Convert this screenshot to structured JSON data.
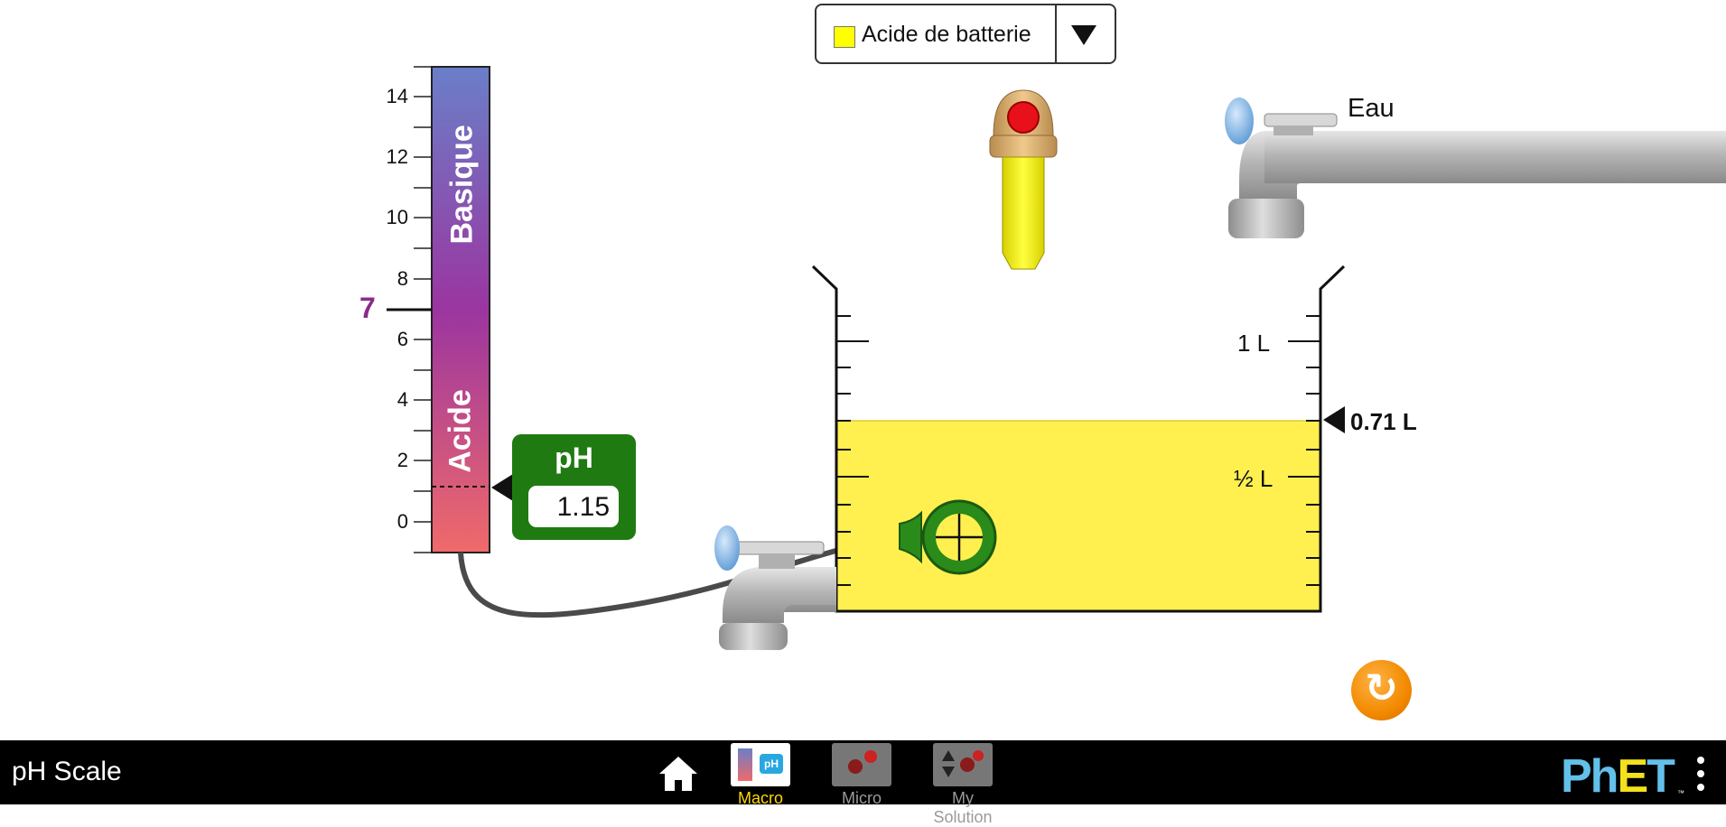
{
  "solute_selector": {
    "selected_label": "Acide de batterie",
    "swatch_color": "#ffff00"
  },
  "ph_scale": {
    "tick_labels": [
      "14",
      "12",
      "10",
      "8",
      "6",
      "4",
      "2",
      "0"
    ],
    "neutral_label": "7",
    "basic_label": "Basique",
    "acidic_label": "Acide",
    "top_color": "#6a7fc8",
    "mid_color": "#9b35a0",
    "bottom_color": "#f06a6a"
  },
  "ph_meter": {
    "title": "pH",
    "value": "1.15",
    "color": "#1f7a12"
  },
  "beaker": {
    "volume_label": "0.71 L",
    "mark_1l": "1 L",
    "mark_half": "½ L",
    "liquid_color": "#fff04f",
    "fill_fraction": 0.71
  },
  "water_faucet": {
    "label": "Eau"
  },
  "icons": {
    "dropper": "dropper-icon",
    "water_faucet": "water-faucet-icon",
    "drain_faucet": "drain-faucet-icon",
    "probe": "ph-probe-icon",
    "reset": "reset-icon",
    "home": "home-icon"
  },
  "nav_bar": {
    "title": "pH Scale",
    "screens": [
      {
        "label": "Macro",
        "selected": true
      },
      {
        "label": "Micro",
        "selected": false
      },
      {
        "label": "My Solution",
        "selected": false
      }
    ],
    "logo": "PhET",
    "accent_color": "#ffd800"
  }
}
